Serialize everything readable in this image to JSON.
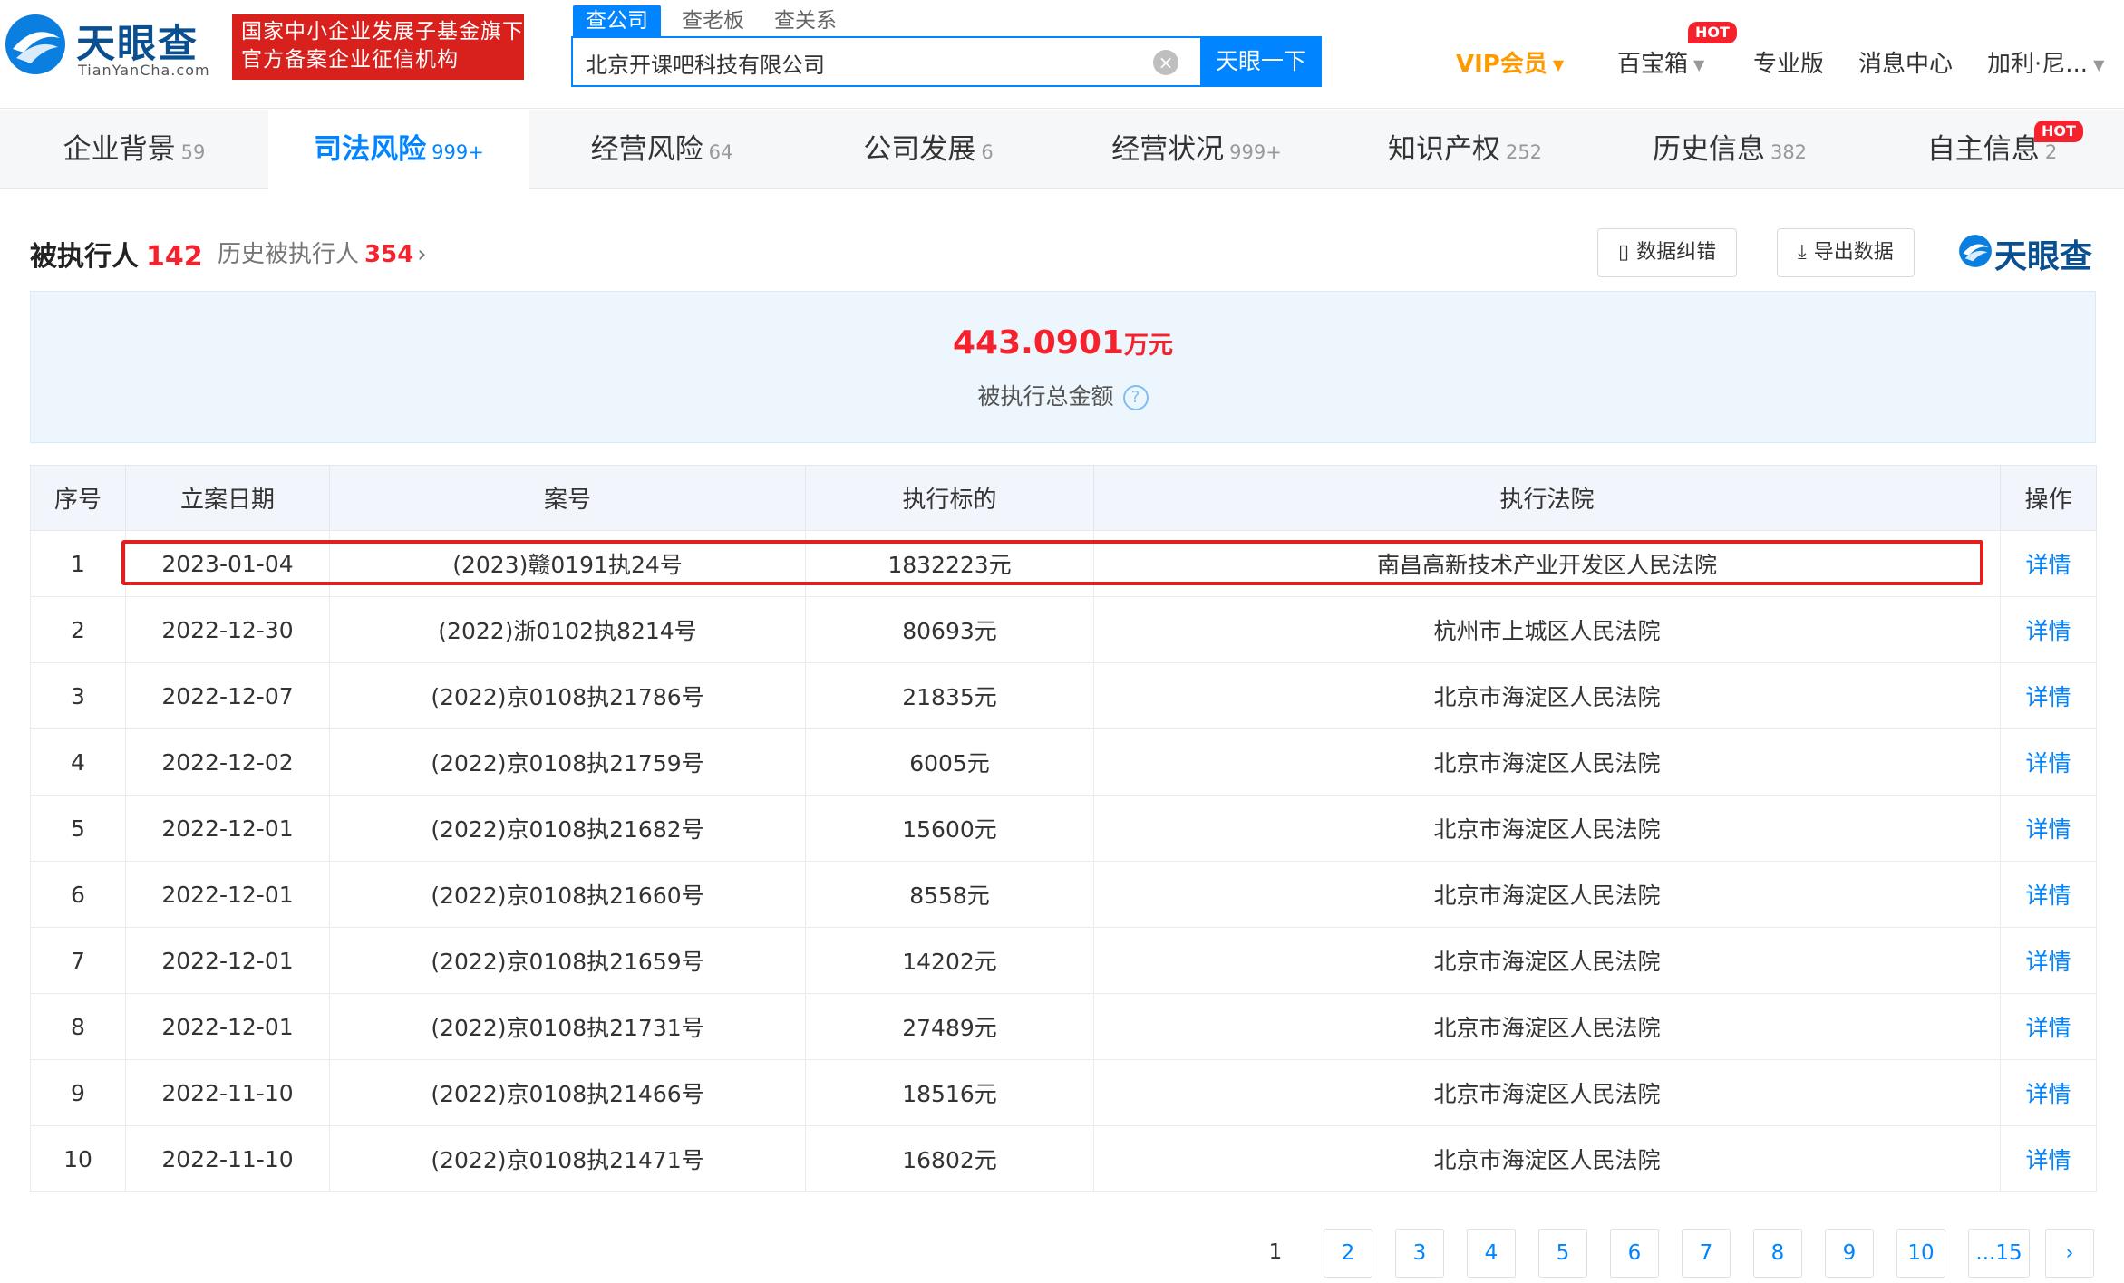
{
  "header": {
    "logo_cn": "天眼查",
    "logo_en": "TianYanCha.com",
    "badge_line1": "国家中小企业发展子基金旗下",
    "badge_line2": "官方备案企业征信机构",
    "search_tabs": [
      "查公司",
      "查老板",
      "查关系"
    ],
    "search_value": "北京开课吧科技有限公司",
    "search_button": "天眼一下",
    "nav": {
      "vip": "VIP会员",
      "treasure": "百宝箱",
      "hot": "HOT",
      "pro": "专业版",
      "messages": "消息中心",
      "user": "加利·尼..."
    }
  },
  "categories": [
    {
      "label": "企业背景",
      "count": "59"
    },
    {
      "label": "司法风险",
      "count": "999+"
    },
    {
      "label": "经营风险",
      "count": "64"
    },
    {
      "label": "公司发展",
      "count": "6"
    },
    {
      "label": "经营状况",
      "count": "999+"
    },
    {
      "label": "知识产权",
      "count": "252"
    },
    {
      "label": "历史信息",
      "count": "382"
    },
    {
      "label": "自主信息",
      "count": "2",
      "hot": "HOT"
    }
  ],
  "section": {
    "title": "被执行人",
    "count": "142",
    "history_label": "历史被执行人",
    "history_count": "354",
    "history_arrow": "›",
    "btn_correct": "数据纠错",
    "btn_export": "导出数据",
    "brand": "天眼查"
  },
  "summary": {
    "amount": "443.0901",
    "unit": "万元",
    "label": "被执行总金额",
    "help": "?"
  },
  "table": {
    "headers": [
      "序号",
      "立案日期",
      "案号",
      "执行标的",
      "执行法院",
      "操作"
    ],
    "rows": [
      {
        "no": "1",
        "date": "2023-01-04",
        "case": "(2023)赣0191执24号",
        "amount": "1832223元",
        "court": "南昌高新技术产业开发区人民法院",
        "action": "详情"
      },
      {
        "no": "2",
        "date": "2022-12-30",
        "case": "(2022)浙0102执8214号",
        "amount": "80693元",
        "court": "杭州市上城区人民法院",
        "action": "详情"
      },
      {
        "no": "3",
        "date": "2022-12-07",
        "case": "(2022)京0108执21786号",
        "amount": "21835元",
        "court": "北京市海淀区人民法院",
        "action": "详情"
      },
      {
        "no": "4",
        "date": "2022-12-02",
        "case": "(2022)京0108执21759号",
        "amount": "6005元",
        "court": "北京市海淀区人民法院",
        "action": "详情"
      },
      {
        "no": "5",
        "date": "2022-12-01",
        "case": "(2022)京0108执21682号",
        "amount": "15600元",
        "court": "北京市海淀区人民法院",
        "action": "详情"
      },
      {
        "no": "6",
        "date": "2022-12-01",
        "case": "(2022)京0108执21660号",
        "amount": "8558元",
        "court": "北京市海淀区人民法院",
        "action": "详情"
      },
      {
        "no": "7",
        "date": "2022-12-01",
        "case": "(2022)京0108执21659号",
        "amount": "14202元",
        "court": "北京市海淀区人民法院",
        "action": "详情"
      },
      {
        "no": "8",
        "date": "2022-12-01",
        "case": "(2022)京0108执21731号",
        "amount": "27489元",
        "court": "北京市海淀区人民法院",
        "action": "详情"
      },
      {
        "no": "9",
        "date": "2022-11-10",
        "case": "(2022)京0108执21466号",
        "amount": "18516元",
        "court": "北京市海淀区人民法院",
        "action": "详情"
      },
      {
        "no": "10",
        "date": "2022-11-10",
        "case": "(2022)京0108执21471号",
        "amount": "16802元",
        "court": "北京市海淀区人民法院",
        "action": "详情"
      }
    ]
  },
  "pagination": {
    "pages": [
      "1",
      "2",
      "3",
      "4",
      "5",
      "6",
      "7",
      "8",
      "9",
      "10",
      "...15"
    ],
    "current": "1",
    "next": "›"
  },
  "colors": {
    "brand_blue": "#0084ff",
    "risk_red": "#f5222d",
    "vip_orange": "#ff9900",
    "highlight_red": "#e02020"
  }
}
